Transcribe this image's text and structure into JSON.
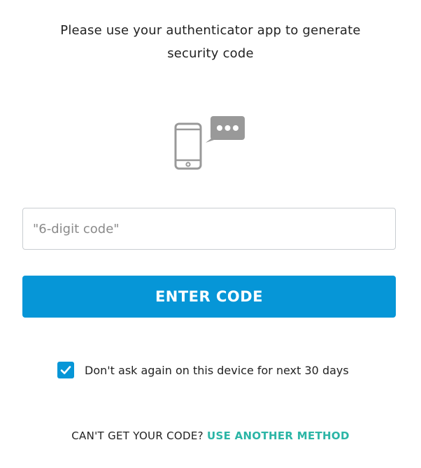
{
  "instructions": {
    "line1": "Please use your authenticator app to generate",
    "line2": "security code"
  },
  "illustration": {
    "icon": "phone-with-message-bubble-icon"
  },
  "code_input": {
    "placeholder": "\"6-digit code\"",
    "value": ""
  },
  "enter_button": {
    "label": "ENTER CODE"
  },
  "remember_device": {
    "checked": true,
    "label": "Don't ask again on this device for next 30 days"
  },
  "footer": {
    "prefix": "CAN'T GET YOUR CODE?",
    "link": "USE ANOTHER METHOD"
  },
  "colors": {
    "primary": "#0696d7",
    "link": "#2bb5a6",
    "icon_gray": "#999999"
  }
}
